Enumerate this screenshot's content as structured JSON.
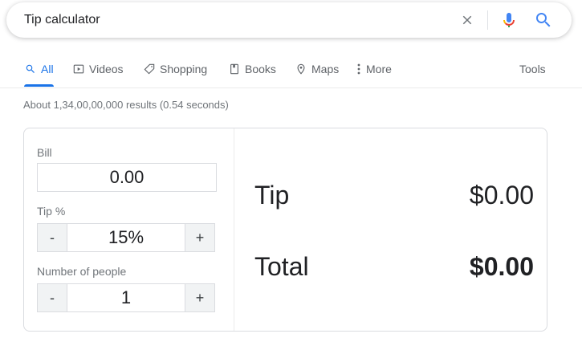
{
  "search": {
    "query": "Tip calculator",
    "clear_icon": "close-icon",
    "mic_icon": "microphone-icon",
    "search_icon": "search-icon"
  },
  "tabs": [
    {
      "label": "All",
      "icon": "search-icon",
      "active": true
    },
    {
      "label": "Videos",
      "icon": "video-icon"
    },
    {
      "label": "Shopping",
      "icon": "tag-icon"
    },
    {
      "label": "Books",
      "icon": "book-icon"
    },
    {
      "label": "Maps",
      "icon": "map-pin-icon"
    },
    {
      "label": "More",
      "icon": "more-vert-icon"
    }
  ],
  "tools_label": "Tools",
  "result_stats": "About 1,34,00,00,000 results (0.54 seconds)",
  "calculator": {
    "bill_label": "Bill",
    "bill_value": "0.00",
    "tip_label": "Tip %",
    "tip_value": "15%",
    "people_label": "Number of people",
    "people_value": "1",
    "minus": "-",
    "plus": "+",
    "tip_result_label": "Tip",
    "tip_result_value": "$0.00",
    "total_label": "Total",
    "total_value": "$0.00"
  },
  "colors": {
    "accent": "#1a73e8",
    "mic_blue": "#4285f4",
    "mic_red": "#ea4335",
    "mic_yellow": "#fbbc04",
    "mic_green": "#34a853"
  }
}
